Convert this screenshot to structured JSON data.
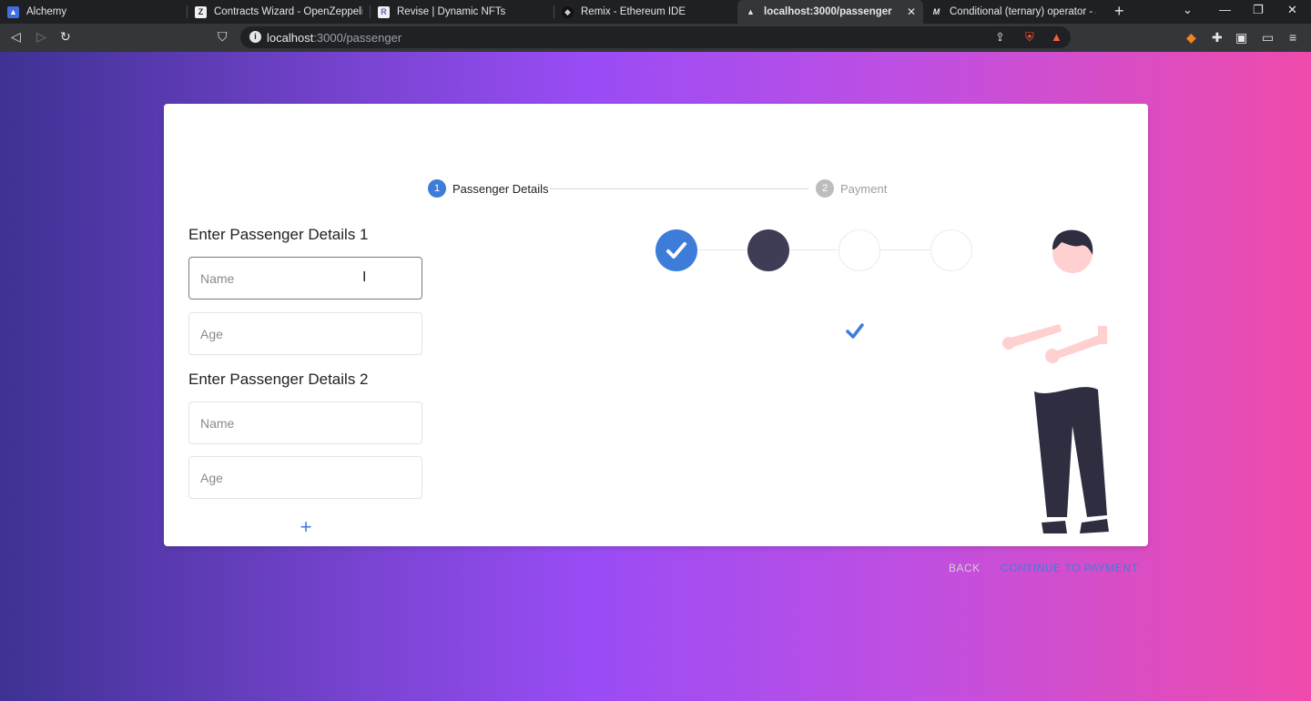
{
  "browser": {
    "tabs": [
      {
        "title": "Alchemy",
        "icon": "alchemy-icon"
      },
      {
        "title": "Contracts Wizard - OpenZeppelin Docs",
        "icon": "openzeppelin-icon"
      },
      {
        "title": "Revise | Dynamic NFTs",
        "icon": "revise-icon"
      },
      {
        "title": "Remix - Ethereum IDE",
        "icon": "remix-icon"
      },
      {
        "title": "localhost:3000/passenger",
        "icon": "localhost-icon",
        "active": true
      },
      {
        "title": "Conditional (ternary) operator - JavaScript",
        "icon": "mdn-icon"
      }
    ],
    "address": {
      "host": "localhost",
      "path": ":3000/passenger"
    }
  },
  "stepper": {
    "steps": [
      {
        "number": "1",
        "label": "Passenger Details",
        "active": true
      },
      {
        "number": "2",
        "label": "Payment",
        "active": false
      }
    ]
  },
  "form": {
    "sections": [
      {
        "title": "Enter Passenger Details 1",
        "name_placeholder": "Name",
        "age_placeholder": "Age"
      },
      {
        "title": "Enter Passenger Details 2",
        "name_placeholder": "Name",
        "age_placeholder": "Age"
      }
    ],
    "add_symbol": "+"
  },
  "actions": {
    "back_label": "BACK",
    "continue_label": "CONTINUE TO PAYMENT"
  },
  "colors": {
    "accent": "#3d7dd9",
    "step_inactive": "#bdbdbd",
    "dark_dot": "#3f3d56",
    "gradient_start": "#3e3293",
    "gradient_end": "#ef4bab"
  }
}
